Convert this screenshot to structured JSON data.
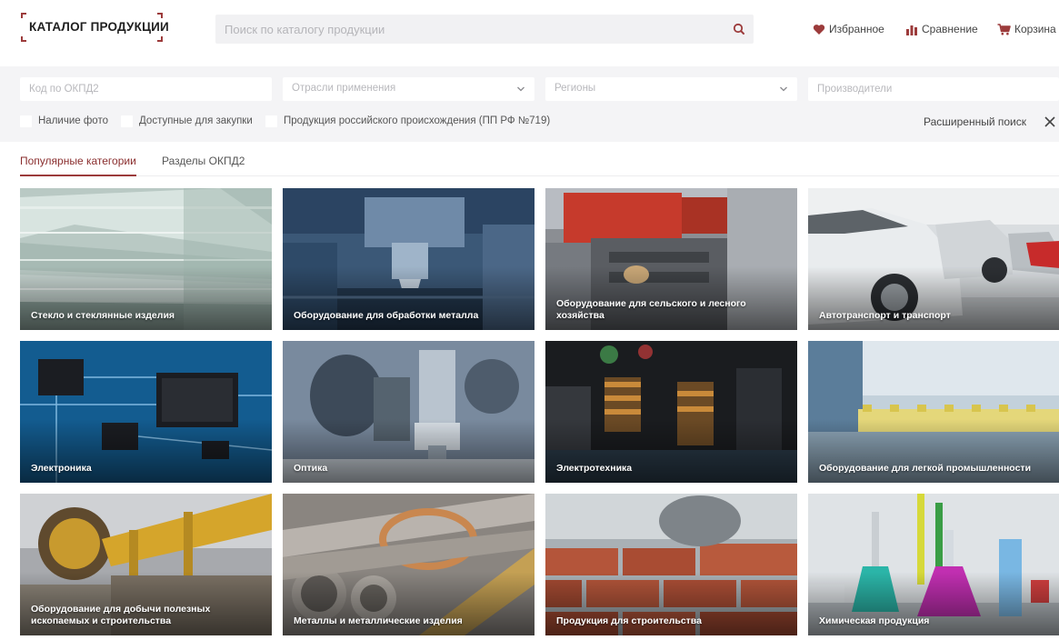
{
  "header": {
    "logo_text": "КАТАЛОГ ПРОДУКЦИИ",
    "search_placeholder": "Поиск по каталогу продукции",
    "favorites_label": "Избранное",
    "compare_label": "Сравнение",
    "cart_label": "Корзина",
    "accent_color": "#9c3b3b"
  },
  "filters": {
    "okpd_placeholder": "Код по ОКПД2",
    "industries_value": "Отрасли применения",
    "regions_value": "Регионы",
    "manufacturers_placeholder": "Производители",
    "checkbox_photo": "Наличие фото",
    "checkbox_available": "Доступные для закупки",
    "checkbox_russian": "Продукция российского происхождения (ПП РФ №719)",
    "advanced_search": "Расширенный поиск"
  },
  "tabs": {
    "popular": "Популярные категории",
    "sections": "Разделы ОКПД2"
  },
  "categories": [
    "Стекло и стеклянные изделия",
    "Оборудование для обработки металла",
    "Оборудование для сельского и лесного хозяйства",
    "Автотранспорт и транспорт",
    "Электроника",
    "Оптика",
    "Электротехника",
    "Оборудование для легкой промышленности",
    "Оборудование для добычи полезных ископаемых и строительства",
    "Металлы и металлические изделия",
    "Продукция для строительства",
    "Химическая продукция"
  ]
}
